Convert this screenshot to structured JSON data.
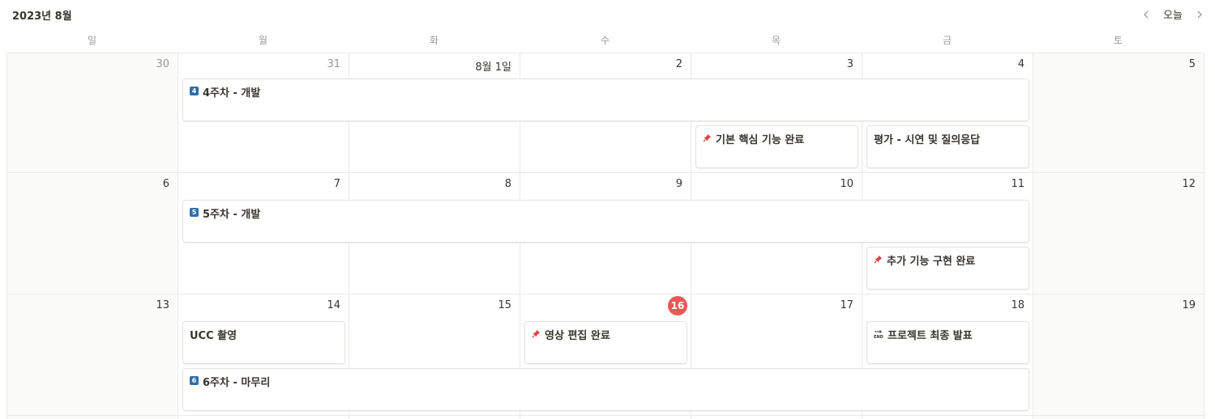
{
  "header": {
    "month_title": "2023년 8월",
    "today_label": "오늘",
    "prev_icon": "chevron-left-icon",
    "next_icon": "chevron-right-icon"
  },
  "weekdays": [
    "일",
    "월",
    "화",
    "수",
    "목",
    "금",
    "토"
  ],
  "weeks": [
    {
      "days": [
        "30",
        "31",
        "8월 1일",
        "2",
        "3",
        "4",
        "5"
      ]
    },
    {
      "days": [
        "6",
        "7",
        "8",
        "9",
        "10",
        "11",
        "12"
      ]
    },
    {
      "days": [
        "13",
        "14",
        "15",
        "16",
        "17",
        "18",
        "19"
      ]
    }
  ],
  "today_day": "16",
  "events": {
    "w1_span": {
      "icon": "4",
      "title": "4주차 - 개발"
    },
    "w1_core": {
      "icon": "pushpin-icon",
      "title": "기본 핵심 기능 완료"
    },
    "w1_eval": {
      "title": "평가 - 시연 및 질의응답"
    },
    "w2_span": {
      "icon": "5",
      "title": "5주차 - 개발"
    },
    "w2_extra": {
      "icon": "pushpin-icon",
      "title": "추가 기능 구현 완료"
    },
    "w3_ucc": {
      "title": "UCC 촬영"
    },
    "w3_video": {
      "icon": "pushpin-icon",
      "title": "영상 편집 완료"
    },
    "w3_final": {
      "icon": "end-arrow-icon",
      "title": "프로젝트 최종 발표"
    },
    "w3_span": {
      "icon": "6",
      "title": "6주차 - 마무리"
    }
  },
  "colors": {
    "today_badge": "#eb5757",
    "number_icon": "#2e6fa8",
    "pin": "#e03e3e",
    "weekend_bg": "#fbfbfa"
  }
}
